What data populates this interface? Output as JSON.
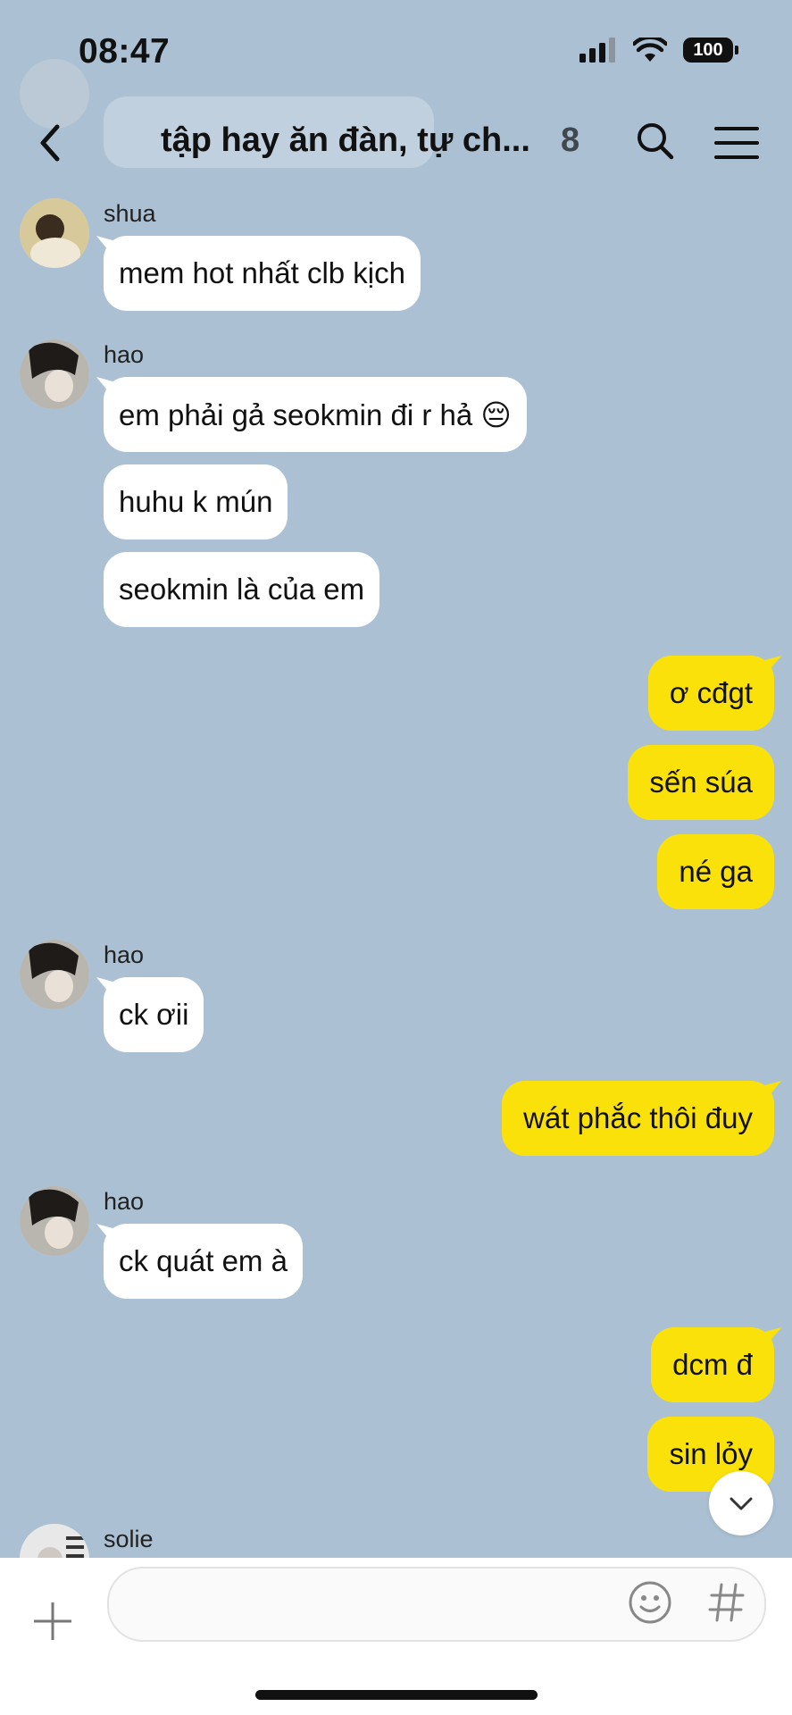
{
  "status_bar": {
    "time": "08:47",
    "battery": "100"
  },
  "header": {
    "title": "tập hay ăn đàn, tự ch...",
    "member_count": "8"
  },
  "messages": [
    {
      "sender": "shua",
      "text": "mem hot nhất clb kịch"
    },
    {
      "sender": "hao",
      "text": "em phải gả seokmin đi r hả 😔"
    },
    {
      "text": "huhu k mún"
    },
    {
      "text": "seokmin là của em"
    },
    {
      "text": "ơ cđgt"
    },
    {
      "text": "sến súa"
    },
    {
      "text": "né ga"
    },
    {
      "sender": "hao",
      "text": "ck ơii"
    },
    {
      "text": "wát phắc thôi đuy"
    },
    {
      "sender": "hao",
      "text": "ck quát em à"
    },
    {
      "text": "dcm đ"
    },
    {
      "text": "sin lỏy"
    },
    {
      "sender": "solie",
      "text": ""
    }
  ],
  "input": {
    "placeholder": "",
    "value": ""
  },
  "colors": {
    "background": "#abc1d3",
    "my_bubble": "#fbe10a",
    "other_bubble": "#ffffff"
  },
  "icons": [
    "back-icon",
    "search-icon",
    "menu-icon",
    "chevron-down-icon",
    "plus-icon",
    "emoji-icon",
    "hashtag-icon"
  ]
}
